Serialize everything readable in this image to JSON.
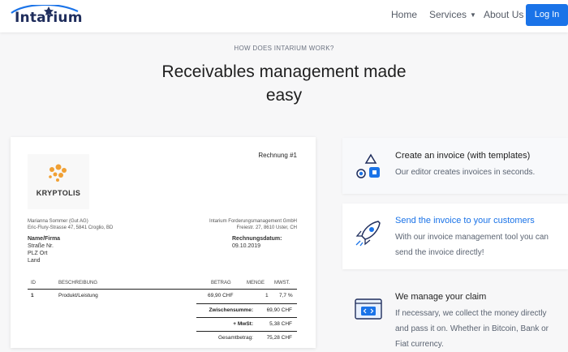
{
  "header": {
    "logo_text": "Intarium",
    "nav": {
      "home": "Home",
      "services": "Services",
      "about": "About Us",
      "login": "Log In"
    }
  },
  "hero": {
    "eyebrow": "HOW DOES INTARIUM WORK?",
    "title": "Receivables management made easy"
  },
  "invoice": {
    "number": "Rechnung #1",
    "brand": "KRYPTOLIS",
    "sender_line1": "Marianna Sommer (Gut AG)",
    "sender_line2": "Eric-Flury-Strasse 47, 5841 Croglio, BD",
    "company_line1": "Intarium Forderungsmanagement GmbH",
    "company_line2": "Freiestr. 27, 8610 Uster, CH",
    "recipient": [
      "Name/Firma",
      "Straße Nr.",
      "PLZ Ort",
      "Land"
    ],
    "date_label": "Rechnungsdatum:",
    "date_value": "09.10.2019",
    "columns": [
      "ID",
      "BESCHREIBUNG",
      "BETRAG",
      "MENGE",
      "MWST."
    ],
    "rows": [
      {
        "id": "1",
        "desc": "Produkt/Leistung",
        "amount": "69,90 CHF",
        "qty": "1",
        "vat": "7,7 %"
      }
    ],
    "subtotal_label": "Zwischensumme:",
    "subtotal_value": "69,90 CHF",
    "vat_label": "+ MwSt:",
    "vat_value": "5,38 CHF",
    "total_label": "Gesamtbetrag:",
    "total_value": "75,28 CHF"
  },
  "features": [
    {
      "title": "Create an invoice (with templates)",
      "body": "Our editor creates invoices in seconds."
    },
    {
      "title": "Send the invoice to your customers",
      "body": "With our invoice management tool you can send the invoice directly!"
    },
    {
      "title": "We manage your claim",
      "body": "If necessary, we collect the money directly and pass it on. Whether in Bitcoin, Bank or Fiat currency."
    }
  ],
  "colors": {
    "accent": "#1a73e8",
    "logo": "#1f2d5c",
    "brand_dots": "#f0a034"
  }
}
